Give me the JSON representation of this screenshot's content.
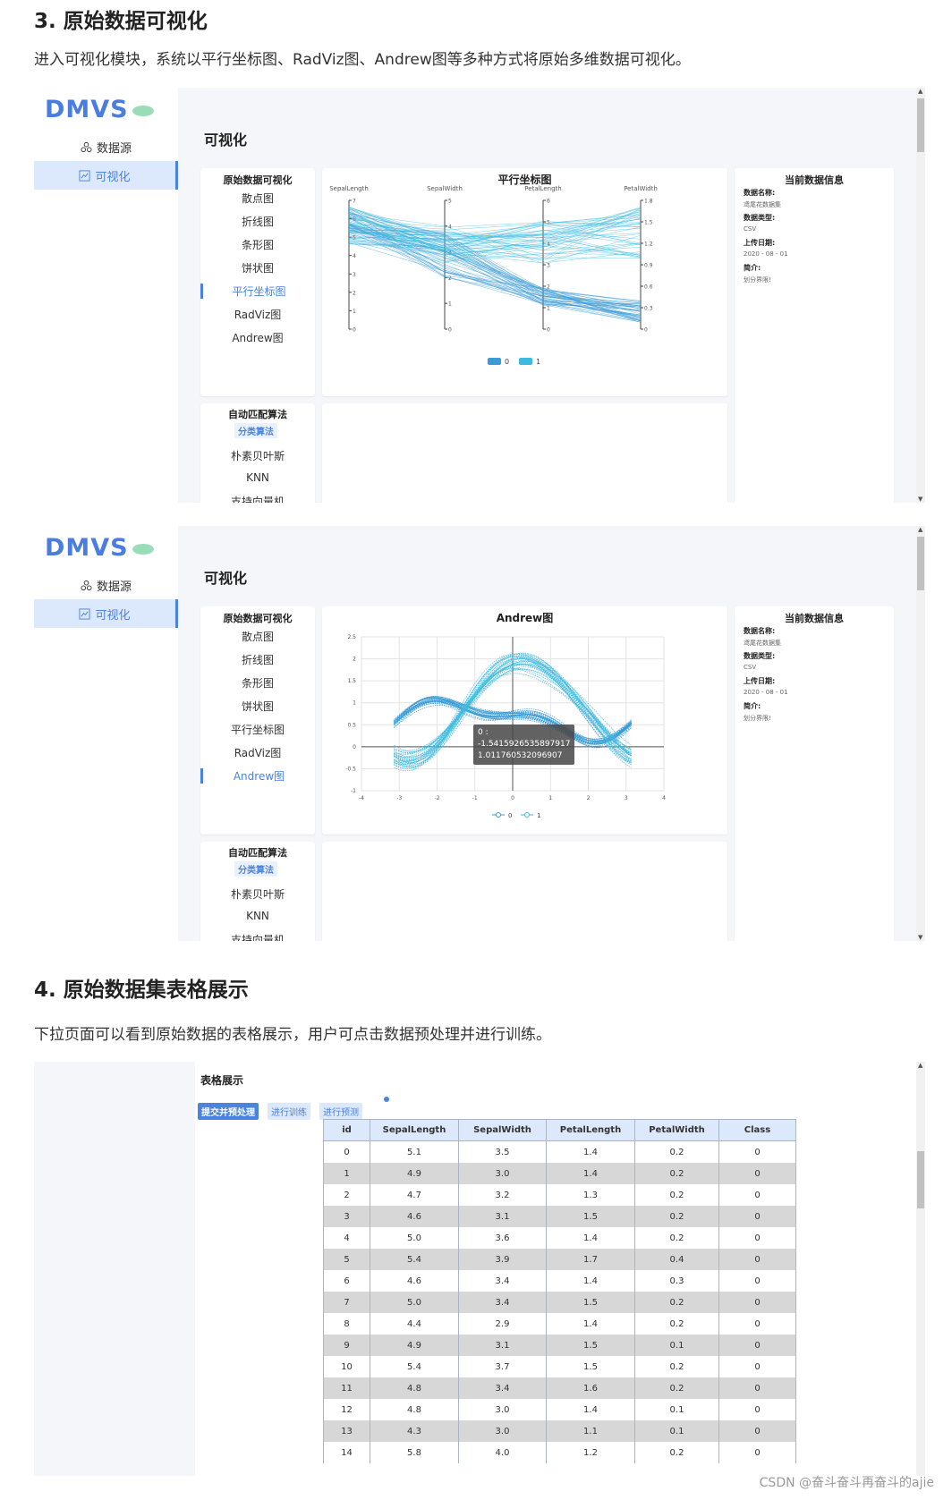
{
  "doc": {
    "heading3": "3. 原始数据可视化",
    "para3": "进入可视化模块，系统以平行坐标图、RadViz图、Andrew图等多种方式将原始多维数据可视化。",
    "heading4": "4. 原始数据集表格展示",
    "para4": "下拉页面可以看到原始数据的表格展示，用户可点击数据预处理并进行训练。",
    "watermark": "CSDN @奋斗奋斗再奋斗的ajie"
  },
  "app": {
    "logo": "DMVS",
    "nav": [
      "数据源",
      "可视化"
    ],
    "page_title": "可视化",
    "menu_title": "原始数据可视化",
    "menu_items": [
      "散点图",
      "折线图",
      "条形图",
      "饼状图",
      "平行坐标图",
      "RadViz图",
      "Andrew图"
    ],
    "algo_title": "自动匹配算法",
    "algo_chip": "分类算法",
    "algo_items": [
      "朴素贝叶斯",
      "KNN",
      "支持向量机"
    ],
    "info_title": "当前数据信息",
    "info": {
      "name_label": "数据名称:",
      "name_value": "鸢尾花数据集",
      "type_label": "数据类型:",
      "type_value": "CSV",
      "date_label": "上传日期:",
      "date_value": "2020 - 08 - 01",
      "desc_label": "简介:",
      "desc_value": "划分界限!"
    },
    "colors": {
      "accent": "#4a83e0",
      "series0": "#3a9bd5",
      "series1": "#3fbadf"
    }
  },
  "chart_data": [
    {
      "type": "parallel",
      "title": "平行坐标图",
      "axes": [
        {
          "name": "SepalLength",
          "ticks": [
            "7",
            "6",
            "5",
            "4",
            "3",
            "2",
            "1",
            "0"
          ]
        },
        {
          "name": "SepalWidth",
          "ticks": [
            "5",
            "4",
            "3",
            "2",
            "1",
            "0"
          ]
        },
        {
          "name": "PetalLength",
          "ticks": [
            "6",
            "5",
            "4",
            "3",
            "2",
            "1",
            "0"
          ]
        },
        {
          "name": "PetalWidth",
          "ticks": [
            "1.8",
            "1.5",
            "1.2",
            "0.9",
            "0.6",
            "0.3",
            "0"
          ]
        }
      ],
      "series": [
        {
          "name": "0"
        },
        {
          "name": "1"
        }
      ],
      "legend": "bottom"
    },
    {
      "type": "line",
      "title": "Andrew图",
      "xlim": [
        -4,
        4
      ],
      "ylim": [
        -1,
        2.5
      ],
      "xticks": [
        "-4",
        "-3",
        "-2",
        "-1",
        "0",
        "1",
        "2",
        "3",
        "4"
      ],
      "yticks": [
        "2.5",
        "2",
        "1.5",
        "1",
        "0.5",
        "0",
        "-0.5",
        "-1"
      ],
      "series": [
        {
          "name": "0"
        },
        {
          "name": "1"
        }
      ],
      "tooltip": {
        "label": "0 :",
        "x": "-1.5415926535897917",
        "y": "1.011760532096907"
      },
      "grid": true,
      "legend": "bottom"
    }
  ],
  "table_section": {
    "title": "表格展示",
    "buttons": [
      "提交并预处理",
      "进行训练",
      "进行预测"
    ],
    "columns": [
      "id",
      "SepalLength",
      "SepalWidth",
      "PetalLength",
      "PetalWidth",
      "Class"
    ],
    "rows": [
      [
        "0",
        "5.1",
        "3.5",
        "1.4",
        "0.2",
        "0"
      ],
      [
        "1",
        "4.9",
        "3.0",
        "1.4",
        "0.2",
        "0"
      ],
      [
        "2",
        "4.7",
        "3.2",
        "1.3",
        "0.2",
        "0"
      ],
      [
        "3",
        "4.6",
        "3.1",
        "1.5",
        "0.2",
        "0"
      ],
      [
        "4",
        "5.0",
        "3.6",
        "1.4",
        "0.2",
        "0"
      ],
      [
        "5",
        "5.4",
        "3.9",
        "1.7",
        "0.4",
        "0"
      ],
      [
        "6",
        "4.6",
        "3.4",
        "1.4",
        "0.3",
        "0"
      ],
      [
        "7",
        "5.0",
        "3.4",
        "1.5",
        "0.2",
        "0"
      ],
      [
        "8",
        "4.4",
        "2.9",
        "1.4",
        "0.2",
        "0"
      ],
      [
        "9",
        "4.9",
        "3.1",
        "1.5",
        "0.1",
        "0"
      ],
      [
        "10",
        "5.4",
        "3.7",
        "1.5",
        "0.2",
        "0"
      ],
      [
        "11",
        "4.8",
        "3.4",
        "1.6",
        "0.2",
        "0"
      ],
      [
        "12",
        "4.8",
        "3.0",
        "1.4",
        "0.1",
        "0"
      ],
      [
        "13",
        "4.3",
        "3.0",
        "1.1",
        "0.1",
        "0"
      ],
      [
        "14",
        "5.8",
        "4.0",
        "1.2",
        "0.2",
        "0"
      ]
    ]
  }
}
